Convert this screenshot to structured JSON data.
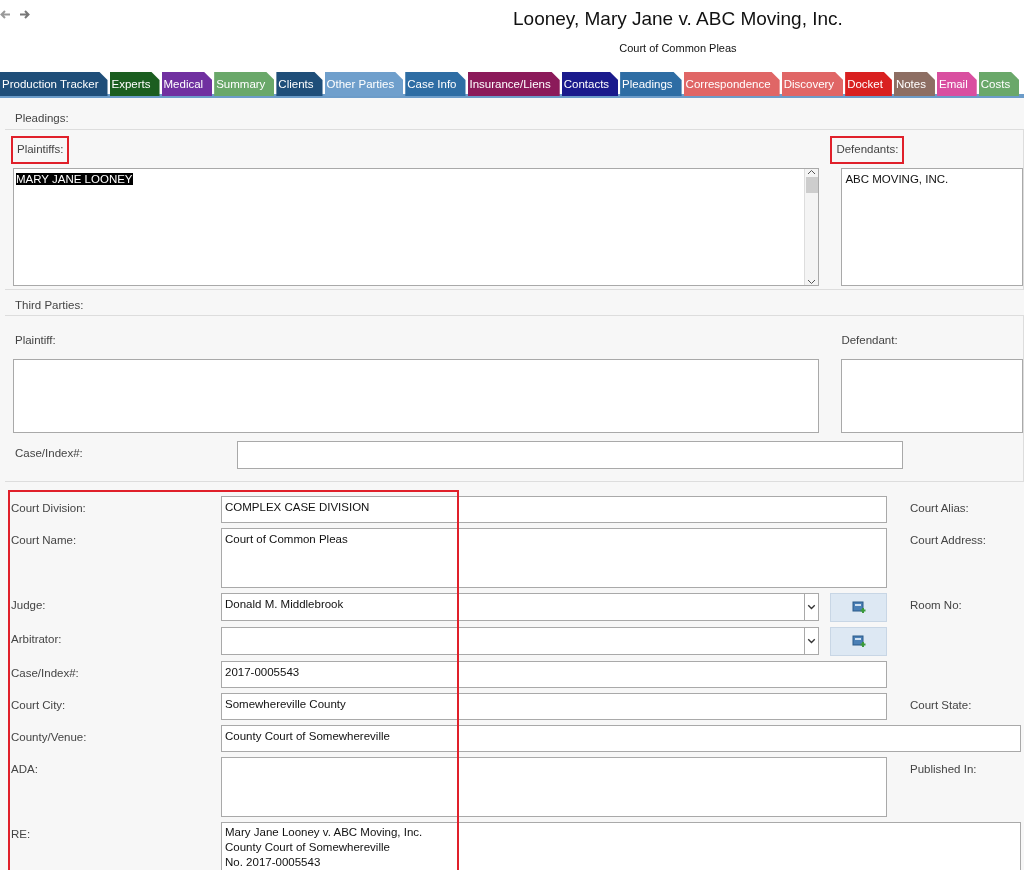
{
  "header": {
    "title": "Looney, Mary Jane v. ABC Moving, Inc.",
    "subtitle": "Court of Common Pleas"
  },
  "tabs": [
    {
      "label": "Production Tracker",
      "color": "#1f4e79"
    },
    {
      "label": "Experts",
      "color": "#1b5e20"
    },
    {
      "label": "Medical",
      "color": "#7030a0"
    },
    {
      "label": "Summary",
      "color": "#6aa86a"
    },
    {
      "label": "Clients",
      "color": "#1f4e79"
    },
    {
      "label": "Other Parties",
      "color": "#6f9fcc"
    },
    {
      "label": "Case Info",
      "color": "#2e6da4"
    },
    {
      "label": "Insurance/Liens",
      "color": "#8b1a5a"
    },
    {
      "label": "Contacts",
      "color": "#1a1a8c"
    },
    {
      "label": "Pleadings",
      "color": "#2e6da4"
    },
    {
      "label": "Correspondence",
      "color": "#e06666"
    },
    {
      "label": "Discovery",
      "color": "#e06666"
    },
    {
      "label": "Docket",
      "color": "#d92020"
    },
    {
      "label": "Notes",
      "color": "#8d6e63"
    },
    {
      "label": "Email",
      "color": "#d94fa0"
    },
    {
      "label": "Costs",
      "color": "#6aa86a"
    }
  ],
  "pleadings": {
    "legend": "Pleadings:",
    "plaintiffs": {
      "label": "Plaintiffs:",
      "highlighted": true,
      "value": "MARY JANE LOONEY",
      "value_selected": true
    },
    "defendants": {
      "label": "Defendants:",
      "highlighted": true,
      "value": "ABC MOVING, INC."
    }
  },
  "third_parties": {
    "legend": "Third Parties:",
    "plaintiff_label": "Plaintiff:",
    "defendant_label": "Defendant:",
    "case_index_label": "Case/Index#:"
  },
  "court": {
    "highlighted": true,
    "rows": [
      {
        "kind": "text",
        "label": "Court Division:",
        "value": "COMPLEX CASE DIVISION",
        "right_label": "Court Alias:"
      },
      {
        "kind": "textarea",
        "label": "Court Name:",
        "value": "Court of Common Pleas",
        "right_label": "Court Address:"
      },
      {
        "kind": "combo",
        "label": "Judge:",
        "value": "Donald M. Middlebrook",
        "right_label": "Room No:"
      },
      {
        "kind": "combo",
        "label": "Arbitrator:"
      },
      {
        "kind": "text",
        "label": "Case/Index#:",
        "value": "2017-0005543"
      },
      {
        "kind": "text",
        "label": "Court City:",
        "value": "Somewhereville County",
        "right_label": "Court State:"
      },
      {
        "kind": "wide",
        "label": "County/Venue:",
        "value": "County Court of Somewhereville"
      },
      {
        "kind": "textarea",
        "label": "ADA:",
        "right_label": "Published In:"
      },
      {
        "kind": "widearea",
        "label": "RE:",
        "lines": [
          "Mary Jane Looney v. ABC Moving, Inc.",
          "County Court of Somewhereville",
          "No. 2017-0005543"
        ]
      }
    ]
  }
}
